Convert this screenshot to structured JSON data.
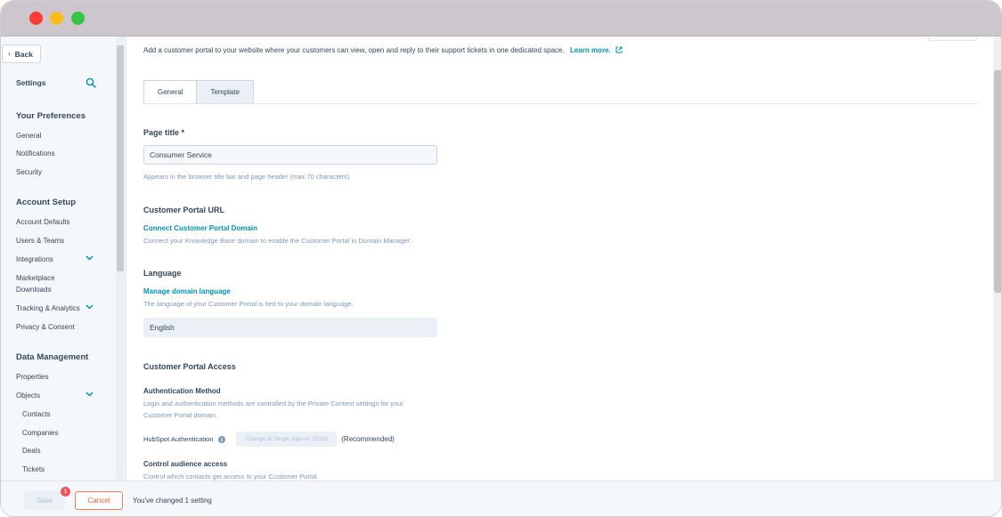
{
  "sidebar": {
    "back_label": "Back",
    "settings_label": "Settings",
    "sections": {
      "preferences": "Your Preferences",
      "account_setup": "Account Setup",
      "data_management": "Data Management"
    },
    "items": {
      "general": "General",
      "notifications": "Notifications",
      "security": "Security",
      "account_defaults": "Account Defaults",
      "users_teams": "Users & Teams",
      "integrations": "Integrations",
      "marketplace_downloads": "Marketplace Downloads",
      "tracking_analytics": "Tracking & Analytics",
      "privacy_consent": "Privacy & Consent",
      "properties": "Properties",
      "objects": "Objects",
      "contacts": "Contacts",
      "companies": "Companies",
      "deals": "Deals",
      "tickets": "Tickets"
    }
  },
  "main": {
    "intro_text": "Add a customer portal to your website where your customers can view, open and reply to their support tickets in one dedicated space.",
    "learn_more": "Learn more.",
    "tabs": [
      "General",
      "Template"
    ],
    "page_title": {
      "label": "Page title *",
      "value": "Consumer Service",
      "help": "Appears in the browser title bar and page header (max 70 characters)"
    },
    "portal_url": {
      "label": "Customer Portal URL",
      "link": "Connect Customer Portal Domain",
      "help": "Connect your Knowledge Base domain to enable the Customer Portal in Domain Manager."
    },
    "language": {
      "label": "Language",
      "link": "Manage domain language",
      "help": "The language of your Customer Portal is tied to your domain language.",
      "value": "English"
    },
    "access": {
      "label": "Customer Portal Access",
      "auth_label": "Authentication Method",
      "auth_help_1": "Login and authentication methods are controlled by the Private Content settings for your",
      "auth_help_2": "Customer Portal domain.",
      "hubspot_auth": "HubSpot Authentication",
      "sso_button": "Change to Single sign-on (SSO)",
      "recommended": "(Recommended)",
      "audience_label": "Control audience access",
      "audience_help": "Control which contacts get access to your Customer Portal"
    }
  },
  "footer": {
    "save_label": "Save",
    "badge_count": "1",
    "cancel_label": "Cancel",
    "status": "You've changed 1 setting"
  },
  "colors": {
    "accent_link": "#0091ae",
    "cancel_orange": "#ff5c35",
    "badge_red": "#f2545b",
    "text_primary": "#33475b"
  }
}
